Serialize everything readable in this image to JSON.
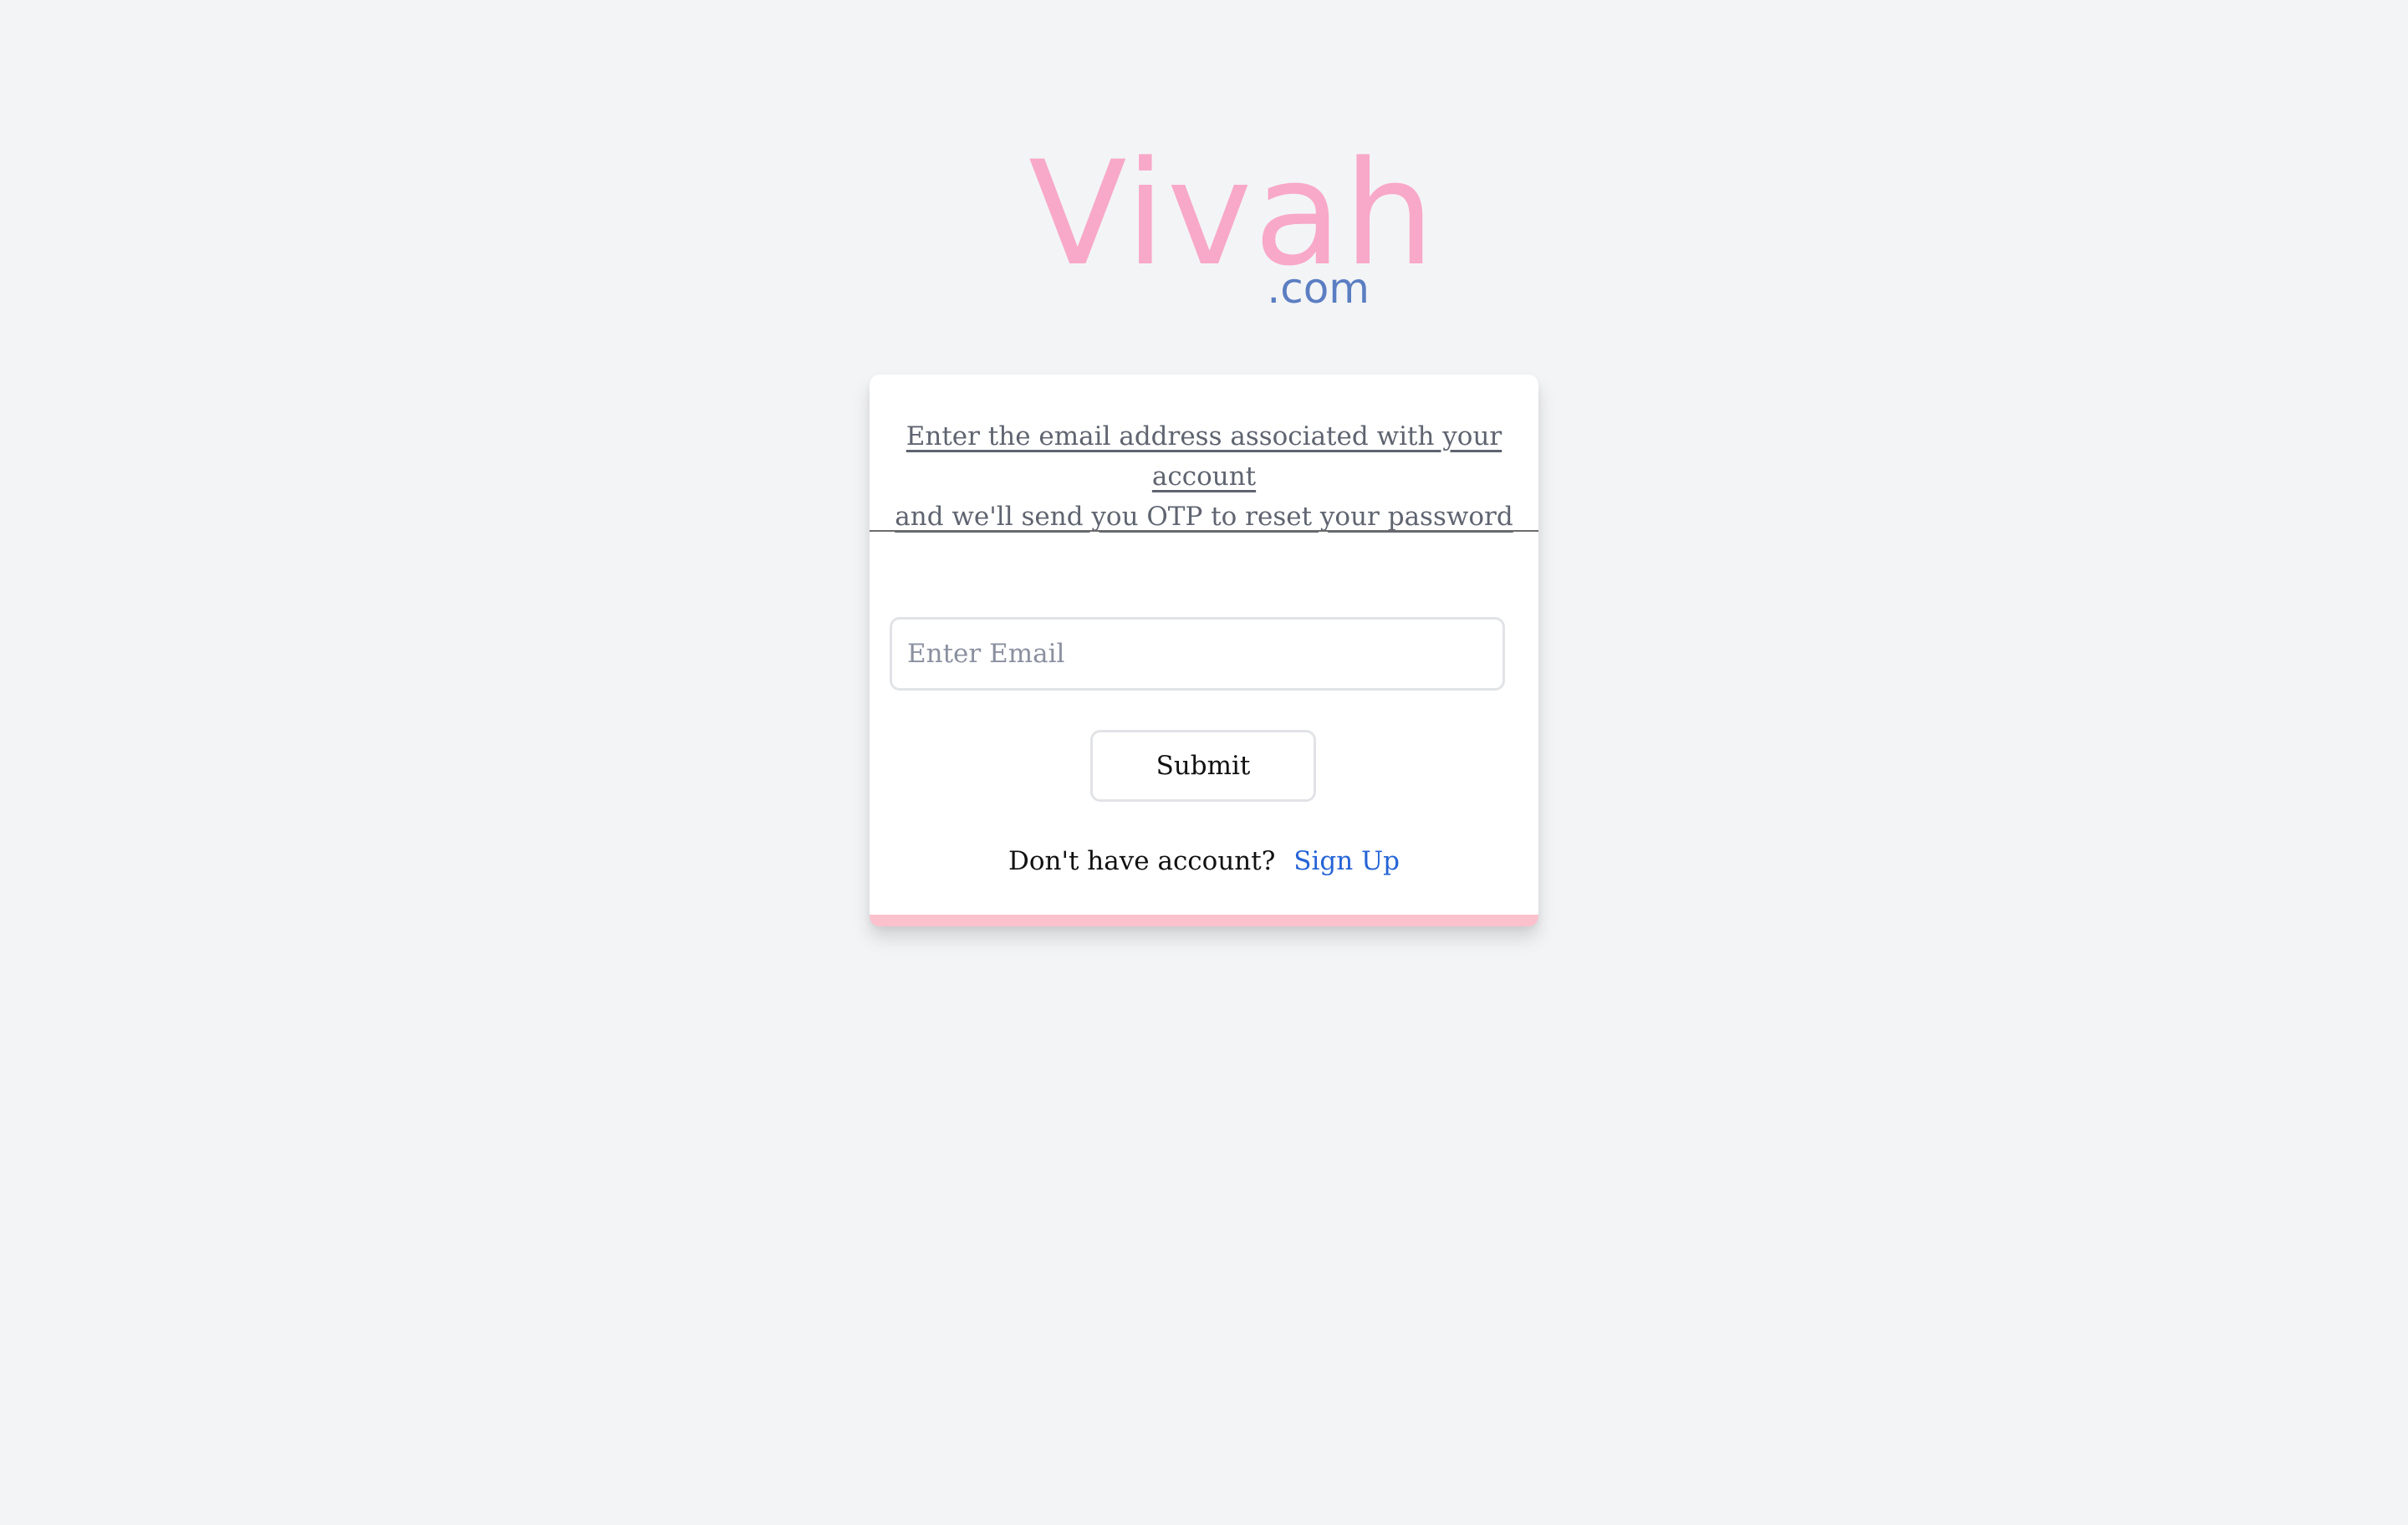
{
  "brand": {
    "name": "Vivah",
    "suffix": ".com",
    "primary_color": "#f8a8c8",
    "secondary_color": "#5b7ec2"
  },
  "form": {
    "instructions_line1": "Enter the email address associated with your account",
    "instructions_line2": "and we'll send you OTP to reset your password",
    "email_placeholder": "Enter Email",
    "email_value": "",
    "submit_label": "Submit",
    "signup_prompt": "Don't have account?",
    "signup_link": "Sign Up"
  },
  "colors": {
    "background": "#f3f4f6",
    "card": "#ffffff",
    "accent_bar": "#fbc1cd",
    "link": "#2563d6"
  }
}
